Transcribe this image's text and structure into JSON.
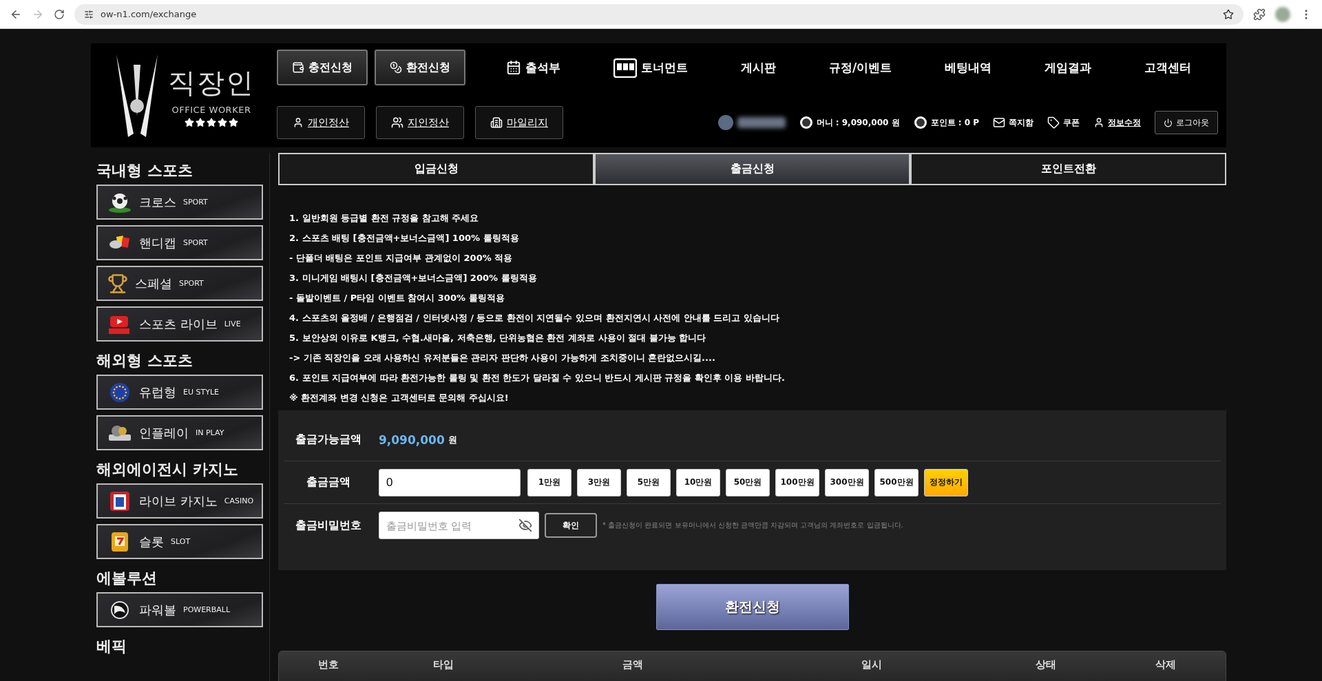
{
  "browser": {
    "url": "ow-n1.com/exchange"
  },
  "header": {
    "logo": {
      "title": "직장인",
      "subtitle": "OFFICE WORKER",
      "stars": 5
    },
    "main_buttons": [
      "충전신청",
      "환전신청"
    ],
    "nav": [
      "출석부",
      "토너먼트",
      "게시판",
      "규정/이벤트",
      "베팅내역",
      "게임결과",
      "고객센터"
    ],
    "sub_buttons": [
      "개인정산",
      "지인정산",
      "마일리지"
    ],
    "user": {
      "money": "머니 : 9,090,000 원",
      "point": "포인트 : 0 P",
      "links": [
        "쪽지함",
        "쿠폰",
        "정보수정"
      ],
      "logout": "로그아웃"
    }
  },
  "sidebar": [
    {
      "title": "국내형 스포츠",
      "items": [
        {
          "label": "크로스",
          "sub": "SPORT"
        },
        {
          "label": "핸디캡",
          "sub": "SPORT"
        },
        {
          "label": "스페셜",
          "sub": "SPORT"
        },
        {
          "label": "스포츠 라이브",
          "sub": "LIVE"
        }
      ]
    },
    {
      "title": "해외형 스포츠",
      "items": [
        {
          "label": "유럽형",
          "sub": "EU STYLE"
        },
        {
          "label": "인플레이",
          "sub": "IN PLAY"
        }
      ]
    },
    {
      "title": "해외에이전시 카지노",
      "items": [
        {
          "label": "라이브 카지노",
          "sub": "CASINO"
        },
        {
          "label": "슬롯",
          "sub": "SLOT"
        }
      ]
    },
    {
      "title": "에볼루션",
      "items": [
        {
          "label": "파워볼",
          "sub": "POWERBALL"
        }
      ]
    },
    {
      "title": "베픽"
    }
  ],
  "tabs": [
    {
      "label": "입금신청",
      "selected": false
    },
    {
      "label": "출금신청",
      "selected": true
    },
    {
      "label": "포인트전환",
      "selected": false
    }
  ],
  "notices": [
    "1. 일반회원 등급별 환전 규정을 참고해 주세요",
    "2. 스포츠 배팅 [충전금액+보너스금액] 100% 롤링적용",
    "- 단폴더 배팅은 포인트 지급여부 관계없이 200% 적용",
    "3. 미니게임 배팅시 [충전금액+보너스금액] 200% 롤링적용",
    "- 돌발이벤트 / P타임 이벤트 참여시 300% 롤링적용",
    "4. 스포츠의 올정배 / 은행점검 / 인터넷사정 / 등으로 환전이 지연될수 있으며 환전지연시 사전에 안내를 드리고 있습니다",
    "5. 보안상의 이유로 K뱅크, 수협.새마을, 저축은행, 단위농협은 환전 계좌로 사용이 절대 불가능 합니다",
    "-> 기존 직장인을 오래 사용하신 유저분들은 관리자 판단하 사용이 가능하게 조치중이니 혼란없으시길....",
    "6. 포인트 지급여부에 따라 환전가능한 롤링 및 환전 한도가 달라질 수 있으니 반드시 게시판 규정을 확인후 이용 바랍니다.",
    "※ 환전계좌 변경 신청은 고객센터로 문의해 주십시요!"
  ],
  "form": {
    "available": {
      "label": "출금가능금액",
      "amount": "9,090,000",
      "unit": "원"
    },
    "amount": {
      "label": "출금금액",
      "value": "0",
      "quick": [
        "1만원",
        "3만원",
        "5만원",
        "10만원",
        "50만원",
        "100만원",
        "300만원",
        "500만원"
      ],
      "reset": "정정하기"
    },
    "password": {
      "label": "출금비밀번호",
      "placeholder": "출금비밀번호 입력",
      "confirm": "확인",
      "hint": "* 출금신청이 완료되면 보유머니에서 신청한 금액만큼 차감되며 고객님의 계좌번호로 입금됩니다."
    }
  },
  "submit": "환전신청",
  "table": {
    "columns": [
      "번호",
      "타입",
      "금액",
      "일시",
      "상태",
      "삭제"
    ]
  }
}
